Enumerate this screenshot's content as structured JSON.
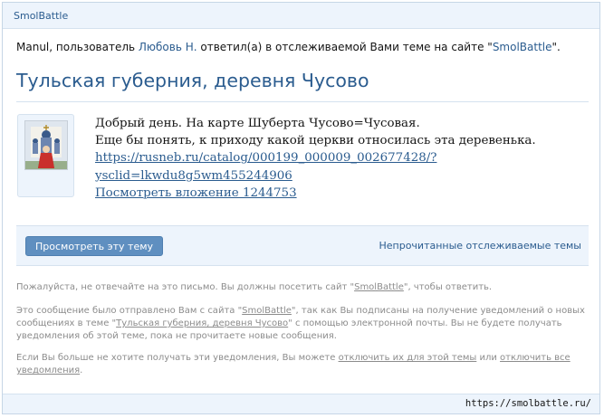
{
  "header": {
    "site_name": "SmolBattle"
  },
  "intro": {
    "user": "Manul",
    "part1": ", пользователь ",
    "author": "Любовь Н.",
    "part2": " ответил(а) в отслеживаемой Вами теме на сайте \"",
    "site": "SmolBattle",
    "part3": "\"."
  },
  "thread": {
    "title": "Тульская губерния, деревня Чусово"
  },
  "message": {
    "line1": "Добрый день. На карте Шуберта Чусово=Чусовая.",
    "line2": "Еще бы понять, к приходу какой церкви относилась эта деревенька.",
    "link_line1": "https://rusneb.ru/catalog/000199_000009_002677428/?",
    "link_line2": "ysclid=lkwdu8g5wm455244906",
    "attachment_link": "Посмотреть вложение 1244753"
  },
  "actions": {
    "view_thread_button": "Просмотреть эту тему",
    "unread_link": "Непрочитанные отслеживаемые темы"
  },
  "footer": {
    "p1_a": "Пожалуйста, не отвечайте на это письмо. Вы должны посетить сайт \"",
    "p1_site": "SmolBattle",
    "p1_b": "\", чтобы ответить.",
    "p2_a": "Это сообщение было отправлено Вам с сайта \"",
    "p2_site": "SmolBattle",
    "p2_b": "\", так как Вы подписаны на получение уведомлений о новых",
    "p2_c": "сообщениях в теме \"",
    "p2_thread": "Тульская губерния, деревня Чусово",
    "p2_d": "\" с помощью электронной почты. Вы не будете получать",
    "p2_e": "уведомления об этой теме, пока не прочитаете новые сообщения.",
    "p3_a": "Если Вы больше не хотите получать эти уведомления, Вы можете ",
    "p3_link1": "отключить их для этой темы",
    "p3_b": " или ",
    "p3_link2a": "отключить все",
    "p3_link2b": "уведомления",
    "p3_c": "."
  },
  "bottom": {
    "url": "https://smolbattle.ru/"
  },
  "colors": {
    "accent": "#2b5c8f",
    "button": "#5f8fc0",
    "bar_bg": "#edf4fc"
  }
}
